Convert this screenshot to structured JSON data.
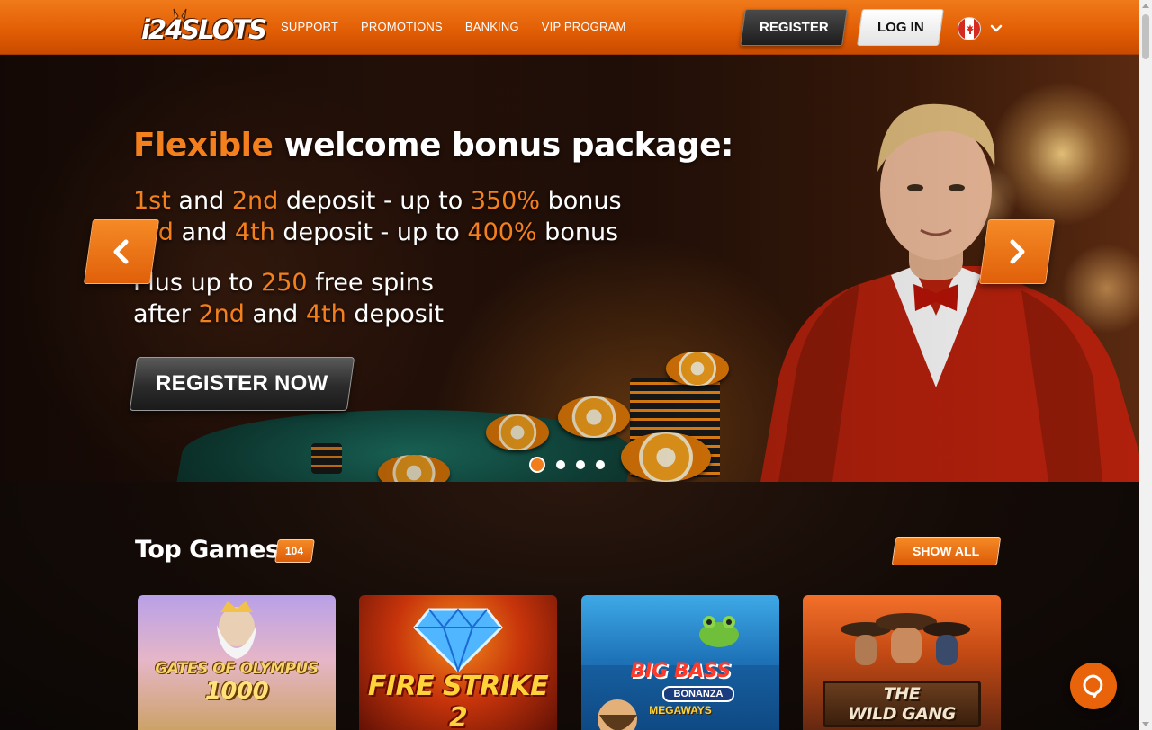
{
  "header": {
    "logo_text": "i24SLOTS",
    "nav": [
      "SUPPORT",
      "PROMOTIONS",
      "BANKING",
      "VIP PROGRAM"
    ],
    "register_label": "REGISTER",
    "login_label": "LOG IN",
    "language_flag": "canada-flag-icon"
  },
  "hero": {
    "title_highlight": "Flexible",
    "title_rest": " welcome bonus package:",
    "line1": {
      "a": "1st",
      "b": " and ",
      "c": "2nd",
      "d": " deposit - up to ",
      "e": "350%",
      "f": " bonus"
    },
    "line2": {
      "a": "3rd",
      "b": " and ",
      "c": "4th",
      "d": " deposit - up to ",
      "e": "400%",
      "f": " bonus"
    },
    "line3": {
      "a": "Plus up to ",
      "b": "250",
      "c": " free spins"
    },
    "line4": {
      "a": "after ",
      "b": "2nd",
      "c": " and ",
      "d": "4th",
      "e": " deposit"
    },
    "cta_label": "REGISTER NOW",
    "slides_count": 4,
    "active_slide": 1
  },
  "games": {
    "title": "Top Games",
    "count": "104",
    "show_all_label": "SHOW ALL",
    "cards": [
      {
        "title_line1": "GATES OF OLYMPUS",
        "title_line2": "1000"
      },
      {
        "title": "FIRE STRIKE 2"
      },
      {
        "title": "BIG BASS",
        "sub": "BONANZA",
        "sub2": "MEGAWAYS"
      },
      {
        "title_line1": "THE",
        "title_line2": "WILD GANG"
      }
    ]
  },
  "colors": {
    "brand_orange": "#f17d1d",
    "header_orange": "#e35f05",
    "dark": "#1c1c1c"
  }
}
